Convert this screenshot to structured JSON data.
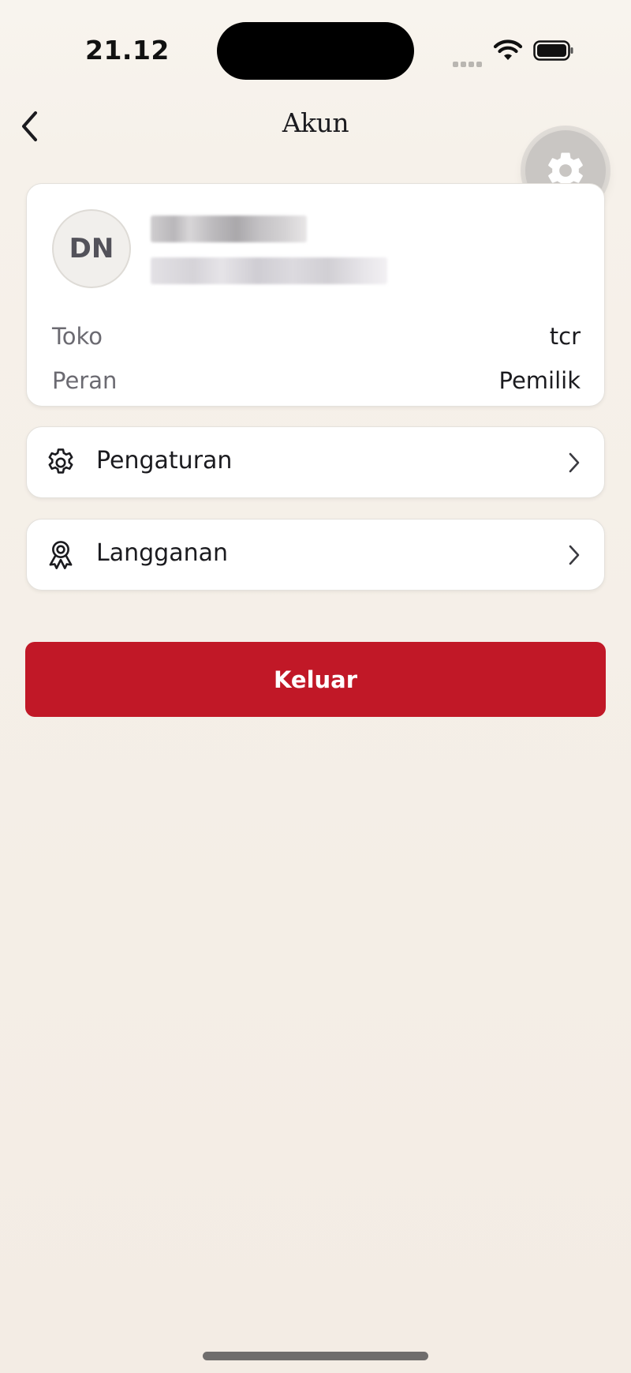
{
  "status_bar": {
    "time": "21.12"
  },
  "header": {
    "title": "Akun",
    "back_icon": "chevron-left-icon"
  },
  "fab": {
    "icon": "gear-icon"
  },
  "profile": {
    "initials": "DN",
    "store_label": "Toko",
    "store_value": "tcr",
    "role_label": "Peran",
    "role_value": "Pemilik"
  },
  "menu": [
    {
      "label": "Pengaturan",
      "icon": "gear-outline-icon"
    },
    {
      "label": "Langganan",
      "icon": "award-ribbon-icon"
    }
  ],
  "logout": {
    "label": "Keluar"
  },
  "colors": {
    "background": "#f5efe7",
    "logout_red": "#c11827",
    "text_primary": "#1b1b1f",
    "text_secondary": "#6b6a71"
  }
}
